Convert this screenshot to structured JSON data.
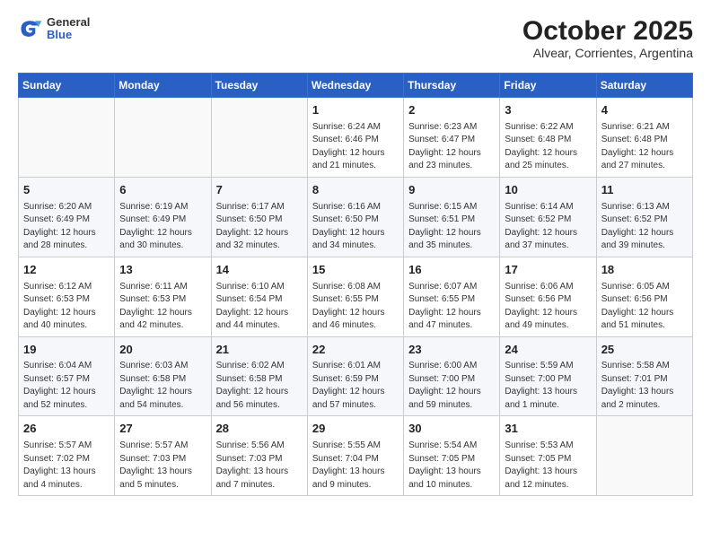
{
  "header": {
    "logo_general": "General",
    "logo_blue": "Blue",
    "title": "October 2025",
    "subtitle": "Alvear, Corrientes, Argentina"
  },
  "weekdays": [
    "Sunday",
    "Monday",
    "Tuesday",
    "Wednesday",
    "Thursday",
    "Friday",
    "Saturday"
  ],
  "weeks": [
    [
      {
        "day": "",
        "info": ""
      },
      {
        "day": "",
        "info": ""
      },
      {
        "day": "",
        "info": ""
      },
      {
        "day": "1",
        "info": "Sunrise: 6:24 AM\nSunset: 6:46 PM\nDaylight: 12 hours\nand 21 minutes."
      },
      {
        "day": "2",
        "info": "Sunrise: 6:23 AM\nSunset: 6:47 PM\nDaylight: 12 hours\nand 23 minutes."
      },
      {
        "day": "3",
        "info": "Sunrise: 6:22 AM\nSunset: 6:48 PM\nDaylight: 12 hours\nand 25 minutes."
      },
      {
        "day": "4",
        "info": "Sunrise: 6:21 AM\nSunset: 6:48 PM\nDaylight: 12 hours\nand 27 minutes."
      }
    ],
    [
      {
        "day": "5",
        "info": "Sunrise: 6:20 AM\nSunset: 6:49 PM\nDaylight: 12 hours\nand 28 minutes."
      },
      {
        "day": "6",
        "info": "Sunrise: 6:19 AM\nSunset: 6:49 PM\nDaylight: 12 hours\nand 30 minutes."
      },
      {
        "day": "7",
        "info": "Sunrise: 6:17 AM\nSunset: 6:50 PM\nDaylight: 12 hours\nand 32 minutes."
      },
      {
        "day": "8",
        "info": "Sunrise: 6:16 AM\nSunset: 6:50 PM\nDaylight: 12 hours\nand 34 minutes."
      },
      {
        "day": "9",
        "info": "Sunrise: 6:15 AM\nSunset: 6:51 PM\nDaylight: 12 hours\nand 35 minutes."
      },
      {
        "day": "10",
        "info": "Sunrise: 6:14 AM\nSunset: 6:52 PM\nDaylight: 12 hours\nand 37 minutes."
      },
      {
        "day": "11",
        "info": "Sunrise: 6:13 AM\nSunset: 6:52 PM\nDaylight: 12 hours\nand 39 minutes."
      }
    ],
    [
      {
        "day": "12",
        "info": "Sunrise: 6:12 AM\nSunset: 6:53 PM\nDaylight: 12 hours\nand 40 minutes."
      },
      {
        "day": "13",
        "info": "Sunrise: 6:11 AM\nSunset: 6:53 PM\nDaylight: 12 hours\nand 42 minutes."
      },
      {
        "day": "14",
        "info": "Sunrise: 6:10 AM\nSunset: 6:54 PM\nDaylight: 12 hours\nand 44 minutes."
      },
      {
        "day": "15",
        "info": "Sunrise: 6:08 AM\nSunset: 6:55 PM\nDaylight: 12 hours\nand 46 minutes."
      },
      {
        "day": "16",
        "info": "Sunrise: 6:07 AM\nSunset: 6:55 PM\nDaylight: 12 hours\nand 47 minutes."
      },
      {
        "day": "17",
        "info": "Sunrise: 6:06 AM\nSunset: 6:56 PM\nDaylight: 12 hours\nand 49 minutes."
      },
      {
        "day": "18",
        "info": "Sunrise: 6:05 AM\nSunset: 6:56 PM\nDaylight: 12 hours\nand 51 minutes."
      }
    ],
    [
      {
        "day": "19",
        "info": "Sunrise: 6:04 AM\nSunset: 6:57 PM\nDaylight: 12 hours\nand 52 minutes."
      },
      {
        "day": "20",
        "info": "Sunrise: 6:03 AM\nSunset: 6:58 PM\nDaylight: 12 hours\nand 54 minutes."
      },
      {
        "day": "21",
        "info": "Sunrise: 6:02 AM\nSunset: 6:58 PM\nDaylight: 12 hours\nand 56 minutes."
      },
      {
        "day": "22",
        "info": "Sunrise: 6:01 AM\nSunset: 6:59 PM\nDaylight: 12 hours\nand 57 minutes."
      },
      {
        "day": "23",
        "info": "Sunrise: 6:00 AM\nSunset: 7:00 PM\nDaylight: 12 hours\nand 59 minutes."
      },
      {
        "day": "24",
        "info": "Sunrise: 5:59 AM\nSunset: 7:00 PM\nDaylight: 13 hours\nand 1 minute."
      },
      {
        "day": "25",
        "info": "Sunrise: 5:58 AM\nSunset: 7:01 PM\nDaylight: 13 hours\nand 2 minutes."
      }
    ],
    [
      {
        "day": "26",
        "info": "Sunrise: 5:57 AM\nSunset: 7:02 PM\nDaylight: 13 hours\nand 4 minutes."
      },
      {
        "day": "27",
        "info": "Sunrise: 5:57 AM\nSunset: 7:03 PM\nDaylight: 13 hours\nand 5 minutes."
      },
      {
        "day": "28",
        "info": "Sunrise: 5:56 AM\nSunset: 7:03 PM\nDaylight: 13 hours\nand 7 minutes."
      },
      {
        "day": "29",
        "info": "Sunrise: 5:55 AM\nSunset: 7:04 PM\nDaylight: 13 hours\nand 9 minutes."
      },
      {
        "day": "30",
        "info": "Sunrise: 5:54 AM\nSunset: 7:05 PM\nDaylight: 13 hours\nand 10 minutes."
      },
      {
        "day": "31",
        "info": "Sunrise: 5:53 AM\nSunset: 7:05 PM\nDaylight: 13 hours\nand 12 minutes."
      },
      {
        "day": "",
        "info": ""
      }
    ]
  ]
}
